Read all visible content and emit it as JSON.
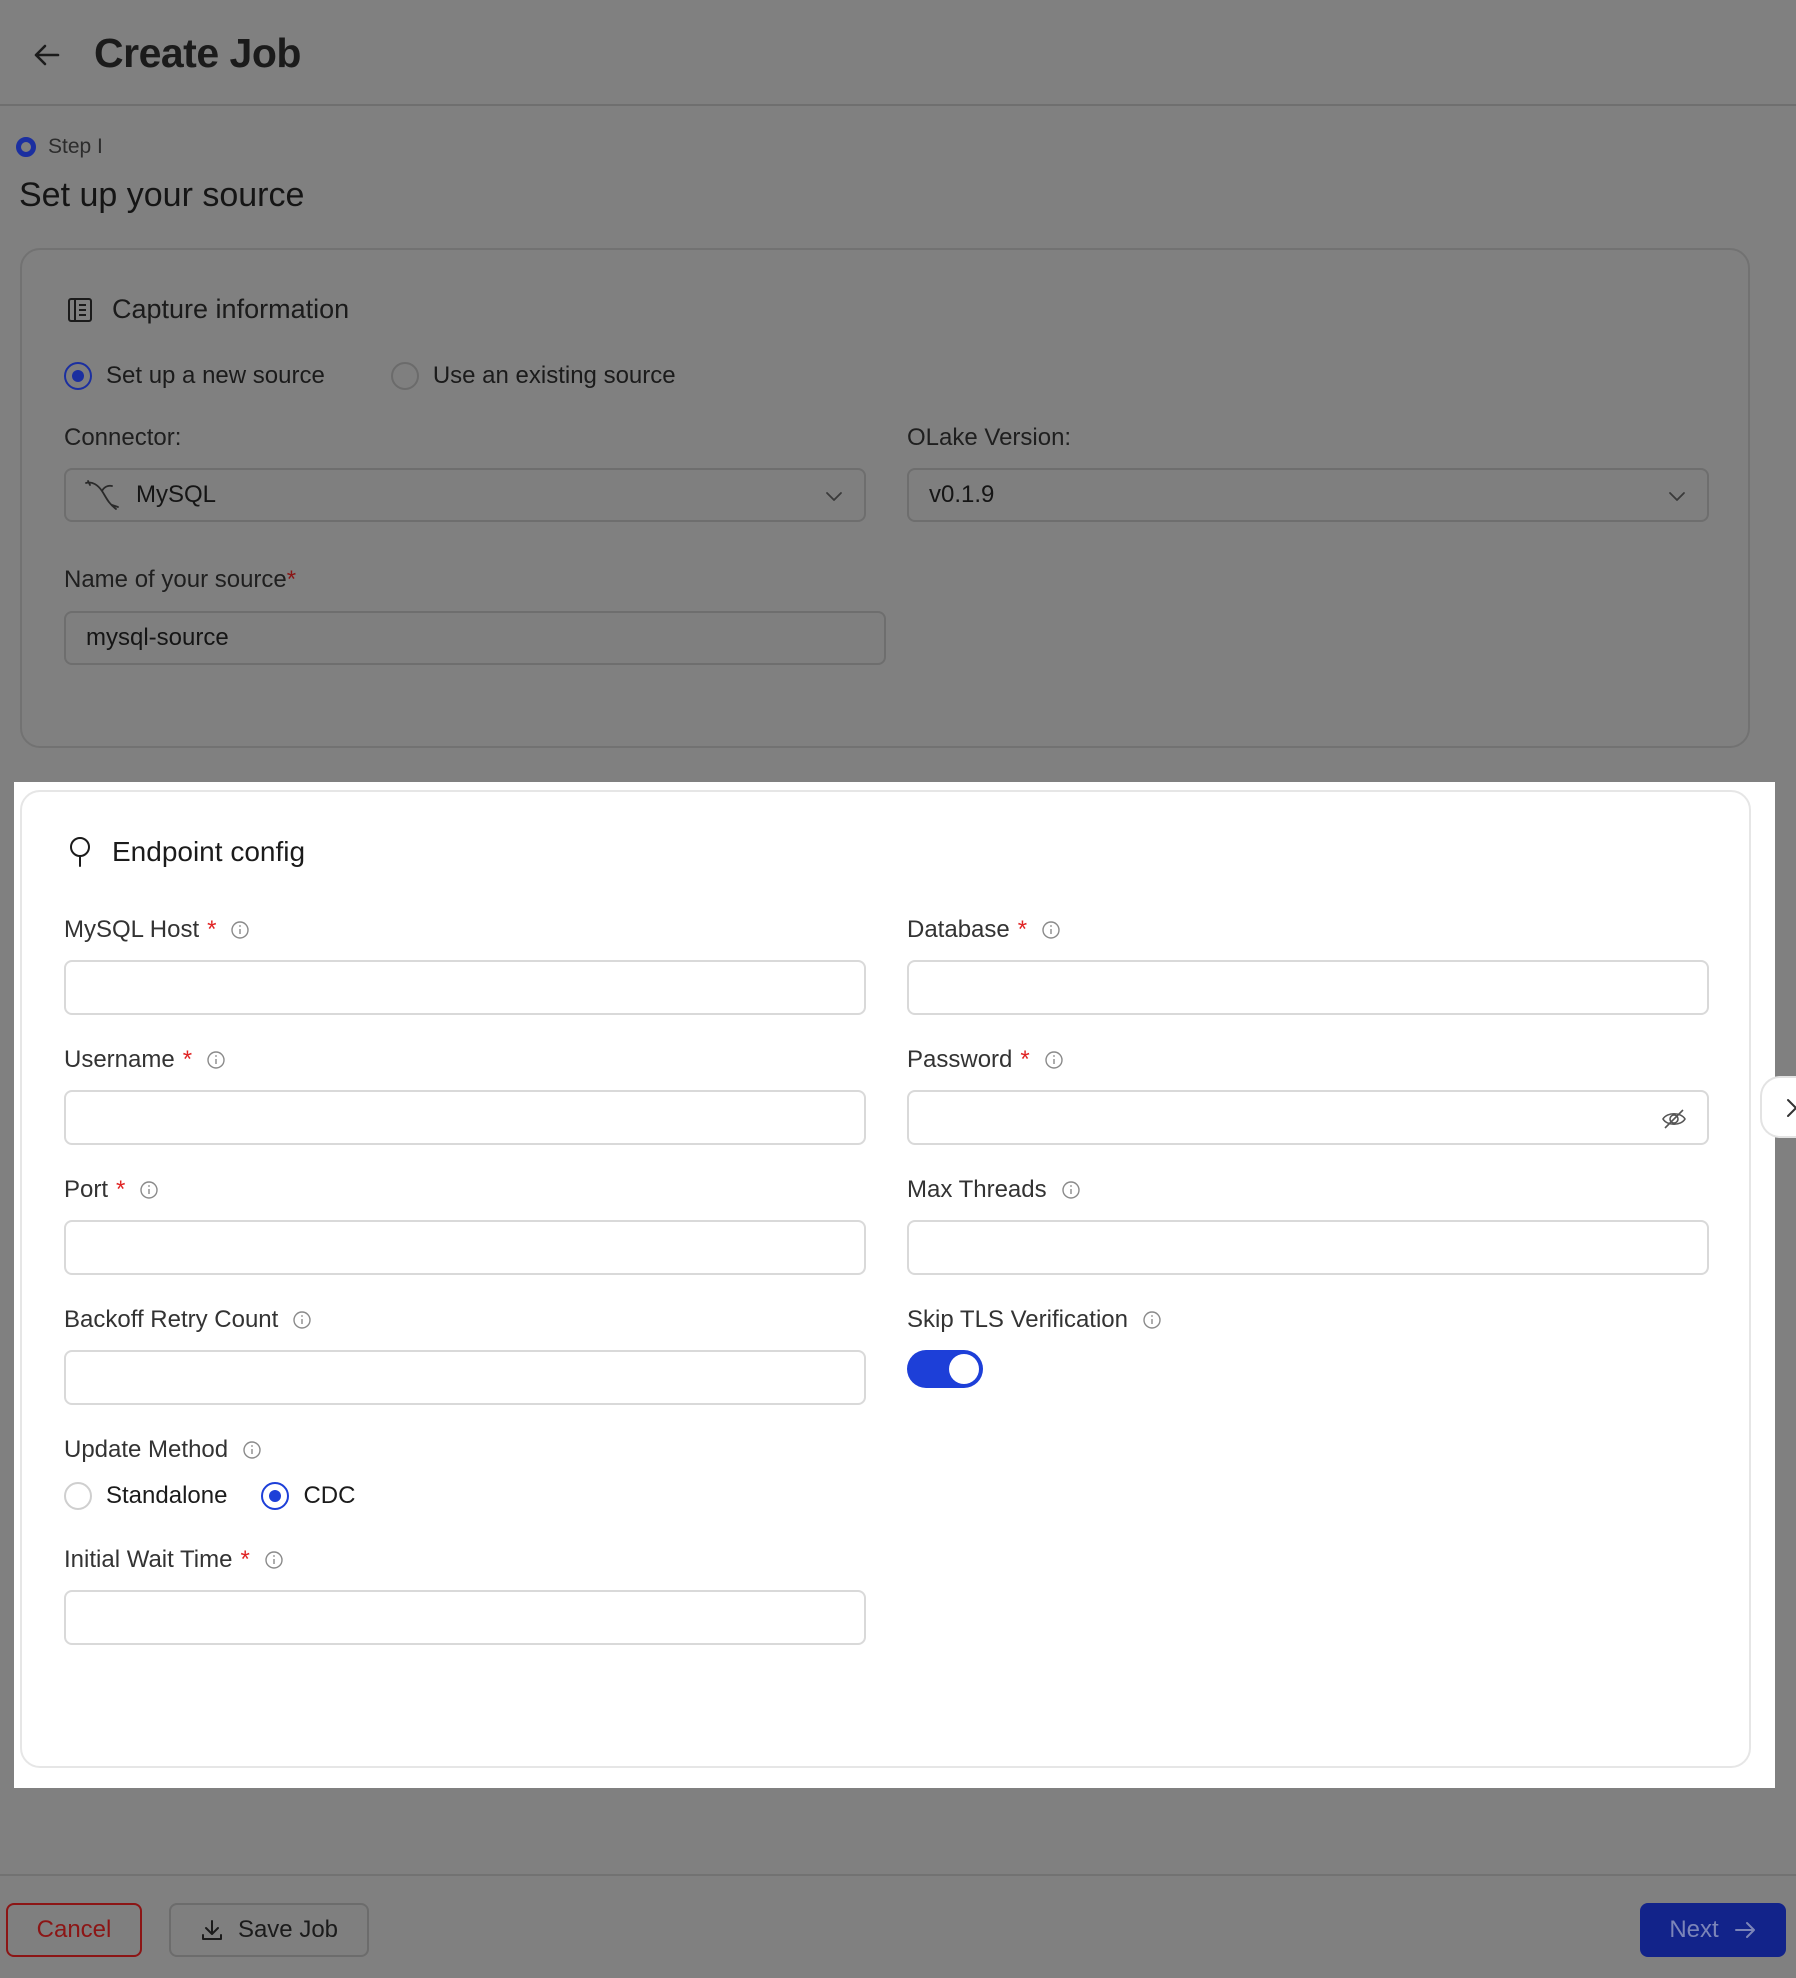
{
  "header": {
    "title": "Create Job"
  },
  "step": {
    "label": "Step I",
    "title": "Set up your source"
  },
  "capture": {
    "title": "Capture information",
    "radio_options": [
      "Set up a new source",
      "Use an existing source"
    ],
    "selected_option": "Set up a new source",
    "connector_label": "Connector:",
    "connector_value": "MySQL",
    "version_label": "OLake Version:",
    "version_value": "v0.1.9",
    "source_name_label": "Name of your source",
    "source_name_required": "*",
    "source_name_value": "mysql-source"
  },
  "endpoint": {
    "title": "Endpoint config",
    "fields": {
      "host": {
        "label": "MySQL Host",
        "required": "*",
        "value": ""
      },
      "database": {
        "label": "Database",
        "required": "*",
        "value": ""
      },
      "username": {
        "label": "Username",
        "required": "*",
        "value": ""
      },
      "password": {
        "label": "Password",
        "required": "*",
        "value": ""
      },
      "port": {
        "label": "Port",
        "required": "*",
        "value": ""
      },
      "max_threads": {
        "label": "Max Threads",
        "value": ""
      },
      "backoff": {
        "label": "Backoff Retry Count",
        "value": ""
      },
      "skip_tls": {
        "label": "Skip TLS Verification",
        "enabled": true
      },
      "update_method": {
        "label": "Update Method",
        "options": [
          "Standalone",
          "CDC"
        ],
        "selected": "CDC"
      },
      "initial_wait": {
        "label": "Initial Wait Time",
        "required": "*",
        "value": ""
      }
    }
  },
  "footer": {
    "cancel_label": "Cancel",
    "save_label": "Save Job",
    "next_label": "Next"
  },
  "colors": {
    "accent": "#1d3fd8",
    "required": "#e02424",
    "overlay": "#808080"
  }
}
